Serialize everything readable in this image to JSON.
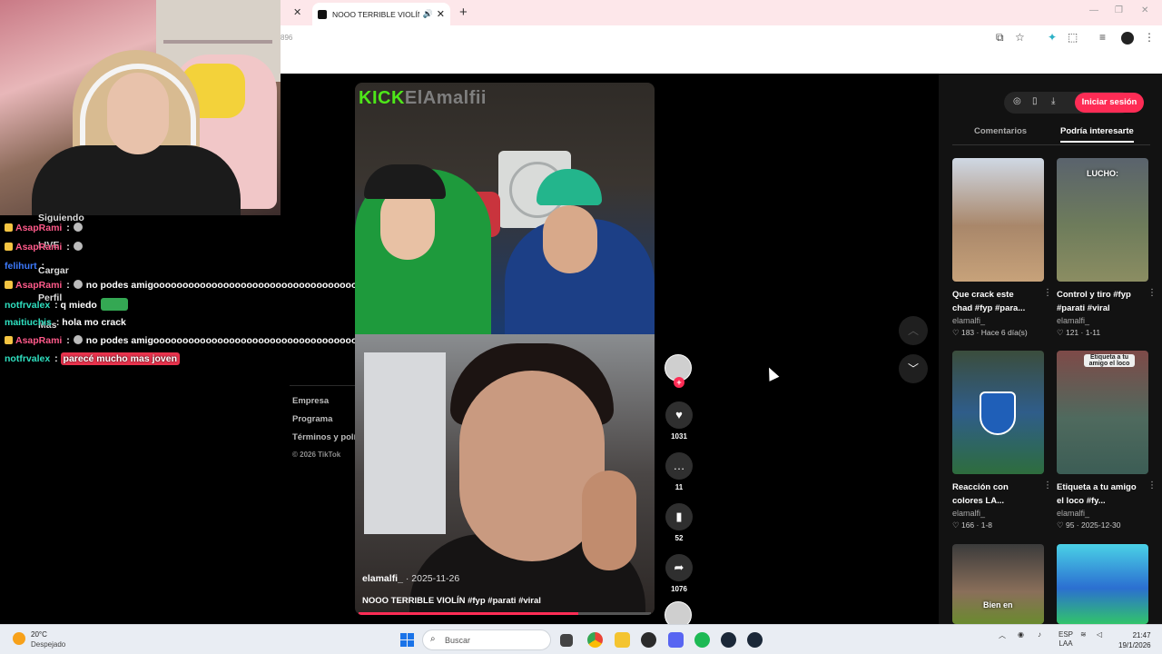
{
  "browser": {
    "tab_title": "NOOO TERRIBLE VIOLÍN #…",
    "url_fragment": "896",
    "speaker_icon": "speaker-icon",
    "new_tab_icon": "plus-icon"
  },
  "chat": {
    "ghost_labels": [
      "Siguiendo",
      "LIVE",
      "Cargar",
      "Perfil",
      "Más"
    ],
    "lines": [
      {
        "user": "AsapRami",
        "sep": " :",
        "msg": "",
        "color": "#ff5a8a"
      },
      {
        "user": "AsapRami",
        "sep": " :",
        "msg": "",
        "color": "#ff5a8a"
      },
      {
        "user": "felihurt",
        "sep": " :",
        "msg": "",
        "color": "#3d7bff"
      },
      {
        "user": "AsapRami",
        "sep": " :",
        "msg": "no podes amigooooooooooooooooooooooooooooooooooo",
        "color": "#ff5a8a"
      },
      {
        "user": "notfrvalex",
        "sep": " :",
        "msg": "q miedo",
        "color": "#2fe0c0"
      },
      {
        "user": "maitiuchis",
        "sep": " :",
        "msg": "hola mo crack",
        "color": "#2fe0c0"
      },
      {
        "user": "AsapRami",
        "sep": " :",
        "msg": "no podes amigooooooooooooooooooooooooooooooooooo",
        "color": "#ff5a8a"
      },
      {
        "user": "notfrvalex",
        "sep": " :",
        "msg": "parecé mucho mas joven",
        "color": "#2fe0c0"
      }
    ]
  },
  "sidebar_footer": {
    "links": [
      "Empresa",
      "Programa",
      "Términos y políticas"
    ],
    "copyright": "© 2026 TikTok"
  },
  "video": {
    "overlay_brand": "KICK",
    "overlay_name": "ElAmalfii",
    "author": "elamalfi_",
    "date": " · 2025-11-26",
    "caption": "NOOO TERRIBLE VIOLÍN #fyp #parati #viral",
    "progress": 0.75
  },
  "actions": {
    "likes": "1031",
    "comments": "11",
    "saves": "52",
    "shares": "1076",
    "icons": [
      "heart-icon",
      "comment-icon",
      "bookmark-icon",
      "share-icon"
    ]
  },
  "right_panel": {
    "login_label": "Iniciar sesión",
    "tabs": [
      "Comentarios",
      "Podría interesarte"
    ],
    "active_tab": "Podría interesarte",
    "cards": [
      {
        "title": "Que crack este chad #fyp #para...",
        "author": "elamalfi_",
        "stats": "♡ 183 · Hace 6 día(s)",
        "overlay": "",
        "bg": "linear-gradient(180deg,#cfd8e4,#a9876a 55%,#c7a27a)"
      },
      {
        "title": "Control y tiro #fyp #parati #viral",
        "author": "elamalfi_",
        "stats": "♡ 121 · 1-11",
        "overlay": "LUCHO:",
        "bg": "linear-gradient(180deg,#5a636d,#6e7c5b 55%,#8b8d62)"
      },
      {
        "title": "Reacción con colores LA...",
        "author": "elamalfi_",
        "stats": "♡ 166 · 1-8",
        "overlay": "",
        "bg": "linear-gradient(180deg,#3b4d3c,#2f5d8a 50%,#2e6d3d)"
      },
      {
        "title": "Etiqueta a tu amigo el loco #fy...",
        "author": "elamalfi_",
        "stats": "♡ 95 · 2025-12-30",
        "overlay": "Etiqueta a tu amigo el loco",
        "bg": "linear-gradient(180deg,#7e4a48,#4f6a5e 55%,#3c5d55)"
      },
      {
        "title": "",
        "author": "",
        "stats": "",
        "overlay": "Bien en",
        "bg": "linear-gradient(180deg,#3b3b3b,#8a6f5a 60%,#6a8a2e)"
      },
      {
        "title": "",
        "author": "",
        "stats": "",
        "overlay": "",
        "bg": "linear-gradient(180deg,#4ad1e6,#2b6fd1 55%,#31c46a)"
      }
    ]
  },
  "taskbar": {
    "temp": "20°C",
    "condition": "Despejado",
    "search_label": "Buscar",
    "lang": "ESP",
    "lang2": "LAA",
    "time": "21:47",
    "date": "19/1/2026"
  }
}
